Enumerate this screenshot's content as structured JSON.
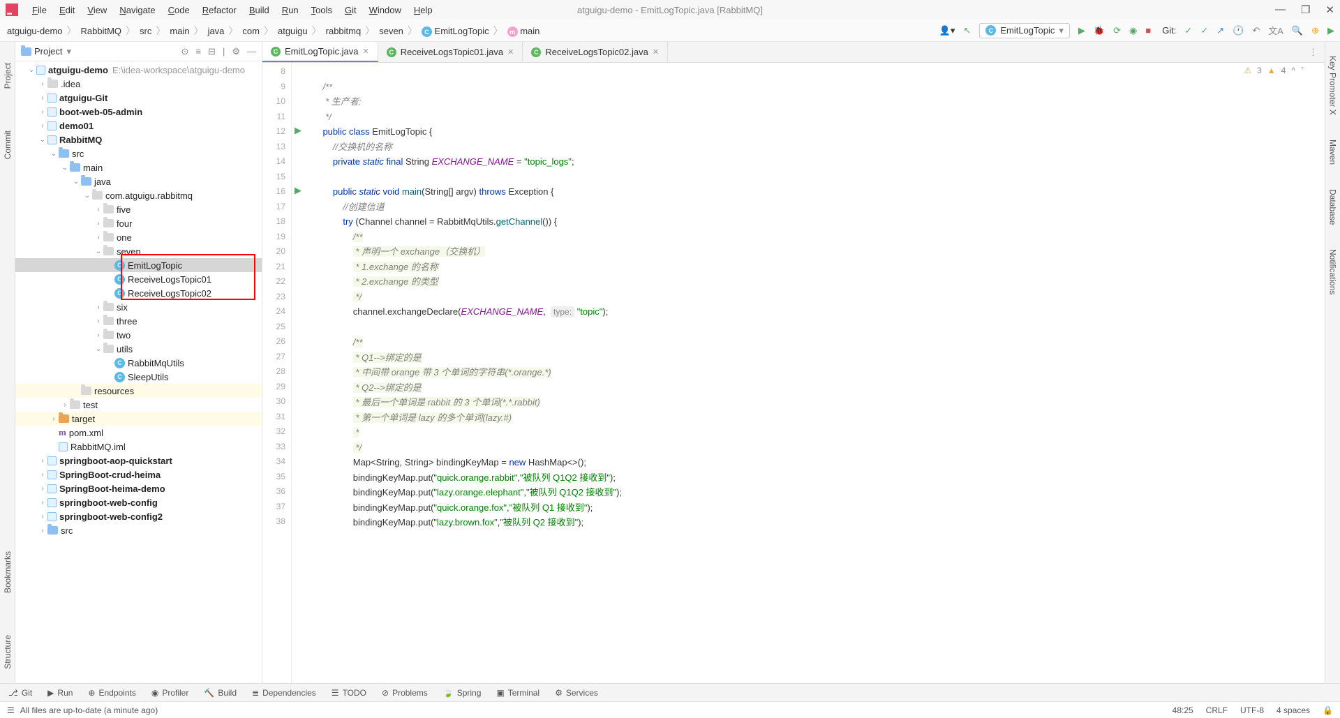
{
  "title": "atguigu-demo - EmitLogTopic.java [RabbitMQ]",
  "menu": [
    "File",
    "Edit",
    "View",
    "Navigate",
    "Code",
    "Refactor",
    "Build",
    "Run",
    "Tools",
    "Git",
    "Window",
    "Help"
  ],
  "breadcrumb": [
    "atguigu-demo",
    "RabbitMQ",
    "src",
    "main",
    "java",
    "com",
    "atguigu",
    "rabbitmq",
    "seven",
    "EmitLogTopic",
    "main"
  ],
  "run_config": "EmitLogTopic",
  "git_label": "Git:",
  "left_strip": [
    "Project",
    "Commit",
    "Bookmarks",
    "Structure"
  ],
  "right_strip": [
    "Key Promoter X",
    "Maven",
    "Database",
    "Notifications"
  ],
  "project_header": "Project",
  "tree": {
    "root": {
      "label": "atguigu-demo",
      "path": "E:\\idea-workspace\\atguigu-demo"
    },
    "items": [
      {
        "d": 1,
        "exp": 1,
        "ic": "mod",
        "label": "atguigu-demo",
        "muted": "E:\\idea-workspace\\atguigu-demo",
        "bold": true
      },
      {
        "d": 2,
        "exp": 0,
        "ic": "fold",
        "label": ".idea"
      },
      {
        "d": 2,
        "exp": 0,
        "ic": "mod",
        "label": "atguigu-Git",
        "bold": true
      },
      {
        "d": 2,
        "exp": 0,
        "ic": "mod",
        "label": "boot-web-05-admin",
        "bold": true
      },
      {
        "d": 2,
        "exp": 0,
        "ic": "mod",
        "label": "demo01",
        "bold": true
      },
      {
        "d": 2,
        "exp": 1,
        "ic": "mod",
        "label": "RabbitMQ",
        "bold": true
      },
      {
        "d": 3,
        "exp": 1,
        "ic": "bluef",
        "label": "src"
      },
      {
        "d": 4,
        "exp": 1,
        "ic": "bluef",
        "label": "main"
      },
      {
        "d": 5,
        "exp": 1,
        "ic": "bluef",
        "label": "java"
      },
      {
        "d": 6,
        "exp": 1,
        "ic": "fold",
        "label": "com.atguigu.rabbitmq"
      },
      {
        "d": 7,
        "exp": 0,
        "ic": "fold",
        "label": "five"
      },
      {
        "d": 7,
        "exp": 0,
        "ic": "fold",
        "label": "four"
      },
      {
        "d": 7,
        "exp": 0,
        "ic": "fold",
        "label": "one"
      },
      {
        "d": 7,
        "exp": 1,
        "ic": "fold",
        "label": "seven"
      },
      {
        "d": 8,
        "exp": -1,
        "ic": "class",
        "label": "EmitLogTopic",
        "sel": true
      },
      {
        "d": 8,
        "exp": -1,
        "ic": "class",
        "label": "ReceiveLogsTopic01"
      },
      {
        "d": 8,
        "exp": -1,
        "ic": "class",
        "label": "ReceiveLogsTopic02"
      },
      {
        "d": 7,
        "exp": 0,
        "ic": "fold",
        "label": "six"
      },
      {
        "d": 7,
        "exp": 0,
        "ic": "fold",
        "label": "three"
      },
      {
        "d": 7,
        "exp": 0,
        "ic": "fold",
        "label": "two"
      },
      {
        "d": 7,
        "exp": 1,
        "ic": "fold",
        "label": "utils"
      },
      {
        "d": 8,
        "exp": -1,
        "ic": "class",
        "label": "RabbitMqUtils"
      },
      {
        "d": 8,
        "exp": -1,
        "ic": "class",
        "label": "SleepUtils"
      },
      {
        "d": 5,
        "exp": -1,
        "ic": "fold",
        "label": "resources",
        "tgt": true
      },
      {
        "d": 4,
        "exp": 0,
        "ic": "fold",
        "label": "test"
      },
      {
        "d": 3,
        "exp": 0,
        "ic": "orangef",
        "label": "target",
        "tgt": true
      },
      {
        "d": 3,
        "exp": -1,
        "ic": "m",
        "label": "pom.xml"
      },
      {
        "d": 3,
        "exp": -1,
        "ic": "mod",
        "label": "RabbitMQ.iml"
      },
      {
        "d": 2,
        "exp": 0,
        "ic": "mod",
        "label": "springboot-aop-quickstart",
        "bold": true
      },
      {
        "d": 2,
        "exp": 0,
        "ic": "mod",
        "label": "SpringBoot-crud-heima",
        "bold": true
      },
      {
        "d": 2,
        "exp": 0,
        "ic": "mod",
        "label": "SpringBoot-heima-demo",
        "bold": true
      },
      {
        "d": 2,
        "exp": 0,
        "ic": "mod",
        "label": "springboot-web-config",
        "bold": true
      },
      {
        "d": 2,
        "exp": 0,
        "ic": "mod",
        "label": "springboot-web-config2",
        "bold": true
      },
      {
        "d": 2,
        "exp": 0,
        "ic": "bluef",
        "label": "src"
      }
    ]
  },
  "tabs": [
    {
      "label": "EmitLogTopic.java",
      "active": true
    },
    {
      "label": "ReceiveLogsTopic01.java"
    },
    {
      "label": "ReceiveLogsTopic02.java"
    }
  ],
  "code_start": 8,
  "code_lines": [
    "",
    "    <span class='doc-cmt2'>/**</span>",
    "    <span class='doc-cmt2'> * 生产者:</span>",
    "    <span class='doc-cmt2'> */</span>",
    "    <span class='kw'>public</span> <span class='kw'>class</span> EmitLogTopic {",
    "        <span class='cmt'>//交换机的名称</span>",
    "        <span class='kw'>private</span> <span class='kw2'>static</span> <span class='kw'>final</span> String <span class='ident'>EXCHANGE_NAME</span> = <span class='str'>\"topic_logs\"</span>;",
    "",
    "        <span class='kw'>public</span> <span class='kw2'>static</span> <span class='kw'>void</span> <span class='mtd'>main</span>(String[] argv) <span class='kw'>throws</span> Exception {",
    "            <span class='cmt'>//创建信道</span>",
    "            <span class='kw'>try</span> (Channel channel = RabbitMqUtils.<span class='mtd'>getChannel</span>()) {",
    "                <span class='doc-cmt'>/**</span>",
    "                <span class='doc-cmt'> * 声明一个 exchange（交换机）</span>",
    "                <span class='doc-cmt'> * 1.exchange 的名称</span>",
    "                <span class='doc-cmt'> * 2.exchange 的类型</span>",
    "                <span class='doc-cmt'> */</span>",
    "                channel.exchangeDeclare(<span class='ident'>EXCHANGE_NAME</span>,  <span class='hint'>type:</span> <span class='str'>\"topic\"</span>);",
    "",
    "                <span class='doc-cmt'>/**</span>",
    "                <span class='doc-cmt'> * Q1--&gt;绑定的是</span>",
    "                <span class='doc-cmt'> * 中间带 orange 带 3 个单词的字符串(*.orange.*)</span>",
    "                <span class='doc-cmt'> * Q2--&gt;绑定的是</span>",
    "                <span class='doc-cmt'> * 最后一个单词是 rabbit 的 3 个单词(*.*.rabbit)</span>",
    "                <span class='doc-cmt'> * 第一个单词是 lazy 的多个单词(lazy.#)</span>",
    "                <span class='doc-cmt'> *</span>",
    "                <span class='doc-cmt'> */</span>",
    "                Map&lt;String, String&gt; bindingKeyMap = <span class='kw'>new</span> HashMap&lt;&gt;();",
    "                bindingKeyMap.put(<span class='str'>\"quick.orange.rabbit\"</span>,<span class='str'>\"被队列 Q1Q2 接收到\"</span>);",
    "                bindingKeyMap.put(<span class='str'>\"lazy.orange.elephant\"</span>,<span class='str'>\"被队列 Q1Q2 接收到\"</span>);",
    "                bindingKeyMap.put(<span class='str'>\"quick.orange.fox\"</span>,<span class='str'>\"被队列 Q1 接收到\"</span>);",
    "                bindingKeyMap.put(<span class='str'>\"lazy.brown.fox\"</span>,<span class='str'>\"被队列 Q2 接收到\"</span>);"
  ],
  "inspection": {
    "warn1": "3",
    "warn2": "4"
  },
  "bottom_tools": [
    "Git",
    "Run",
    "Endpoints",
    "Profiler",
    "Build",
    "Dependencies",
    "TODO",
    "Problems",
    "Spring",
    "Terminal",
    "Services"
  ],
  "status": {
    "msg": "All files are up-to-date (a minute ago)",
    "pos": "48:25",
    "eol": "CRLF",
    "enc": "UTF-8",
    "spaces": "4 spaces"
  }
}
